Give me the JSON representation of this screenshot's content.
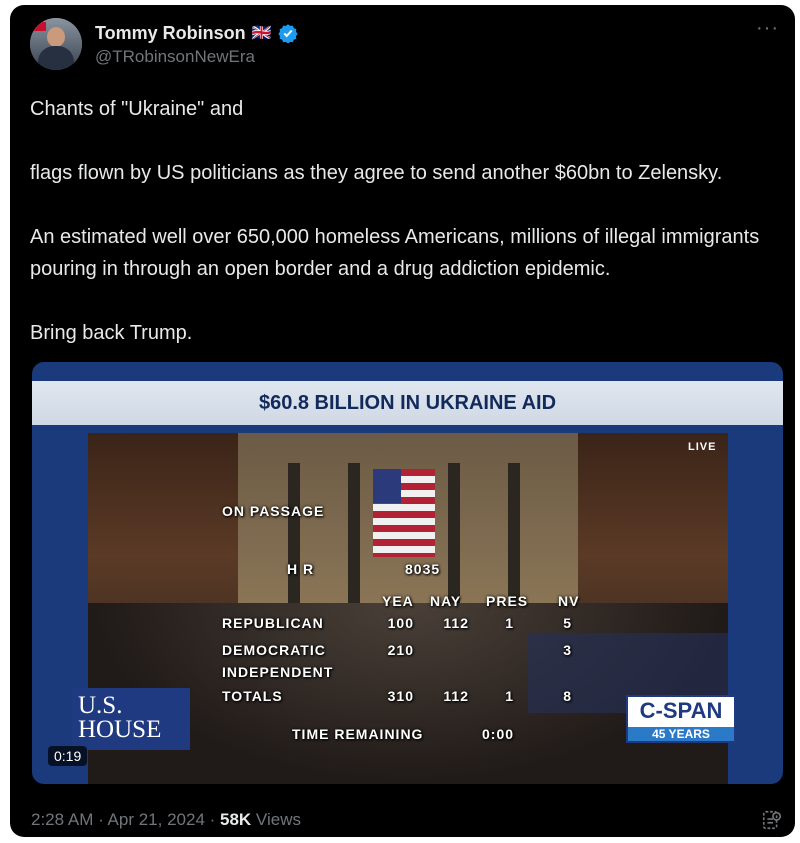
{
  "author": {
    "name": "Tommy Robinson",
    "flag_emoji": "🇬🇧",
    "handle": "@TRobinsonNewEra",
    "verified_icon": "verified-badge-icon",
    "more_label": "···"
  },
  "tweet": {
    "p1_a": "Chants of \"Ukraine\" and",
    "p1_b": "flags flown by US politicians as they agree to send another $60bn to Zelensky.",
    "p2": "An estimated well over 650,000 homeless Americans, millions of illegal immigrants pouring in through an open border and a drug addiction epidemic.",
    "p3": "Bring back Trump.",
    "inline_flag_icon": "ukraine-flag-icon"
  },
  "video": {
    "banner": "$60.8 BILLION IN UKRAINE AID",
    "live": "LIVE",
    "on_passage": "ON PASSAGE",
    "bill_label": "H R",
    "bill_number": "8035",
    "headers": {
      "yea": "YEA",
      "nay": "NAY",
      "pres": "PRES",
      "nv": "NV"
    },
    "rows": [
      {
        "party": "REPUBLICAN",
        "yea": "100",
        "nay": "112",
        "pres": "1",
        "nv": "5"
      },
      {
        "party": "DEMOCRATIC",
        "yea": "210",
        "nay": "",
        "pres": "",
        "nv": "3"
      },
      {
        "party": "INDEPENDENT",
        "yea": "",
        "nay": "",
        "pres": "",
        "nv": ""
      },
      {
        "party": "TOTALS",
        "yea": "310",
        "nay": "112",
        "pres": "1",
        "nv": "8"
      }
    ],
    "time_remaining_label": "TIME REMAINING",
    "time_remaining_value": "0:00",
    "house_logo_line1": "U.S.",
    "house_logo_line2": "HOUSE",
    "cspan_line1": "C-SPAN",
    "cspan_line2": "45 YEARS",
    "duration": "0:19"
  },
  "footer": {
    "time": "2:28 AM",
    "sep1": " · ",
    "date": "Apr 21, 2024",
    "sep2": " · ",
    "views_count": "58K",
    "views_label": " Views",
    "icon": "view-analytics-icon"
  }
}
